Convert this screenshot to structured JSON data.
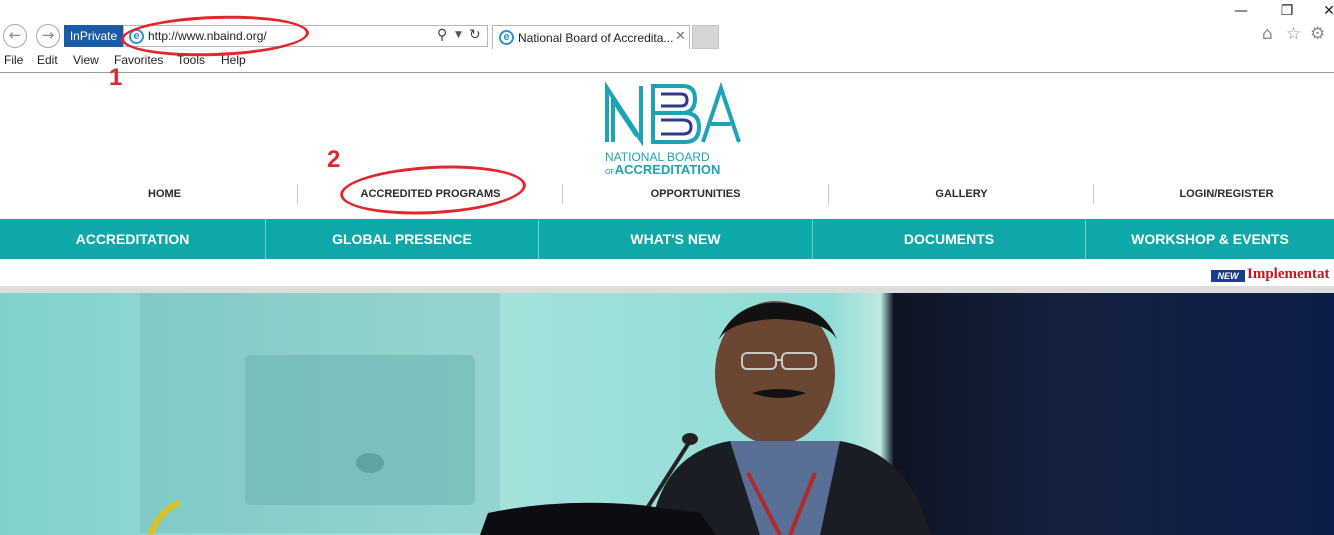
{
  "browser": {
    "inprivate_label": "InPrivate",
    "url": "http://www.nbaind.org/",
    "tab_title": "National Board of Accredita...",
    "menu": [
      "File",
      "Edit",
      "View",
      "Favorites",
      "Tools",
      "Help"
    ]
  },
  "site": {
    "logo": {
      "mark": "NBA",
      "line1": "NATIONAL BOARD",
      "line2_prefix": "OF",
      "line2": "ACCREDITATION"
    },
    "top_nav": [
      "HOME",
      "ACCREDITED PROGRAMS",
      "OPPORTUNITIES",
      "GALLERY",
      "LOGIN/REGISTER"
    ],
    "main_nav": [
      "ACCREDITATION",
      "GLOBAL PRESENCE",
      "WHAT'S NEW",
      "DOCUMENTS",
      "WORKSHOP & EVENTS"
    ],
    "ticker": {
      "badge": "NEW",
      "text": "Implementat"
    }
  },
  "annotations": {
    "marker_1": "1",
    "marker_2": "2"
  },
  "colors": {
    "teal": "#0fa8a8",
    "inprivate": "#1a5aa7",
    "annotation_red": "#e0272b",
    "ticker_red": "#c4161c"
  },
  "icons": [
    "back-arrow-icon",
    "forward-arrow-icon",
    "ie-logo-icon",
    "search-icon",
    "dropdown-icon",
    "refresh-icon",
    "close-icon",
    "home-icon",
    "favorites-star-icon",
    "settings-gear-icon"
  ]
}
